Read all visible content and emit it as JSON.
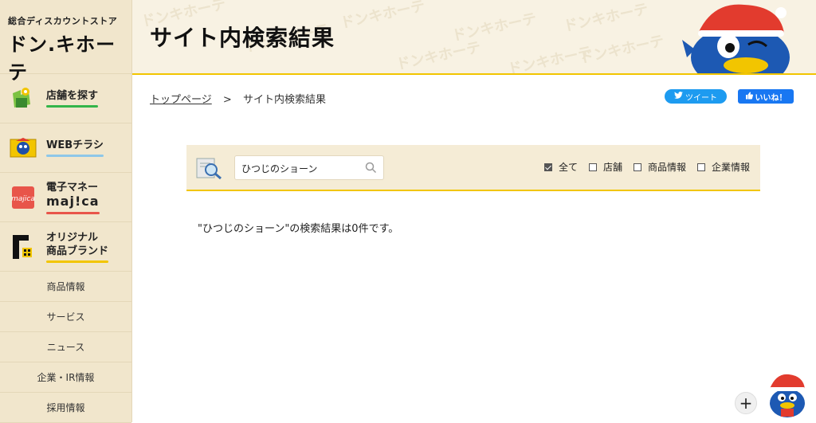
{
  "logo": {
    "subtitle": "総合ディスカウントストア",
    "name": "ドン.キホーテ"
  },
  "sidebar": {
    "big_items": [
      {
        "label": "店舗を探す",
        "icon": "map-pin-icon",
        "color": "#33b54a"
      },
      {
        "label": "WEBチラシ",
        "icon": "flyer-icon",
        "color": "#8ec7e8"
      },
      {
        "label": "電子マネー\nmaj!ca",
        "line1": "電子マネー",
        "line2": "maj!ca",
        "icon": "majica-card-icon",
        "color": "#e8554a"
      },
      {
        "label": "オリジナル\n商品ブランド",
        "line1": "オリジナル",
        "line2": "商品ブランド",
        "icon": "brand-logo-icon",
        "color": "#f2c500"
      }
    ],
    "small_items": [
      "商品情報",
      "サービス",
      "ニュース",
      "企業・IR情報",
      "採用情報"
    ]
  },
  "header": {
    "title": "サイト内検索結果",
    "watermark_text": "ドンキホーテ"
  },
  "breadcrumb": {
    "home": "トップページ",
    "separator": ">",
    "current": "サイト内検索結果"
  },
  "social": {
    "tweet": "ツイート",
    "like": "いいね！"
  },
  "search": {
    "value": "ひつじのショーン",
    "filters": [
      {
        "label": "全て",
        "checked": true
      },
      {
        "label": "店舗",
        "checked": false
      },
      {
        "label": "商品情報",
        "checked": false
      },
      {
        "label": "企業情報",
        "checked": false
      }
    ]
  },
  "result": {
    "message": "\"ひつじのショーン\"の検索結果は0件です。"
  },
  "floating": {
    "plus": "+"
  },
  "colors": {
    "accent_yellow": "#f2c500",
    "sidebar_bg": "#f1e6cc",
    "twitter": "#1d9bf0",
    "facebook": "#1877f2"
  }
}
